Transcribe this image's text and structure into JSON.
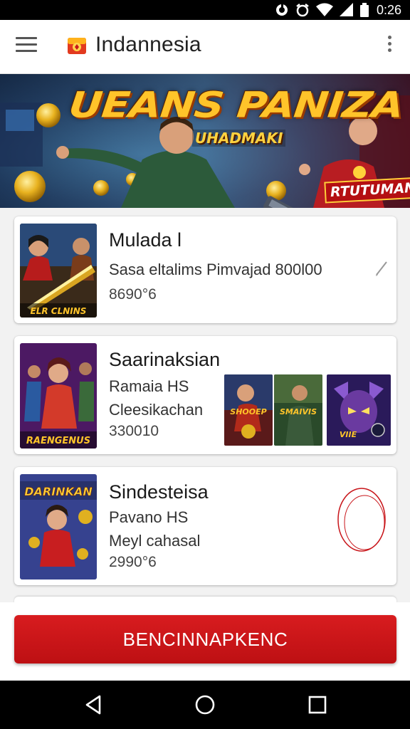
{
  "status_bar": {
    "time": "0:26",
    "icons": [
      "sync-icon",
      "alarm-icon",
      "wifi-icon",
      "signal-icon",
      "battery-icon"
    ]
  },
  "app_bar": {
    "title": "Indannesia",
    "icons": [
      "menu-icon",
      "app-logo-icon",
      "overflow-menu-icon"
    ]
  },
  "banner": {
    "title": "UEANS PANIZA",
    "subtitle": "UHADMAKI",
    "tag": "RTUTUMAN"
  },
  "cards": [
    {
      "title": "Mulada l",
      "line1": "Sasa eltalims  Pimvajad 800l00",
      "line2": "",
      "number": "8690°6",
      "thumb_caption": "ELR CLNINS",
      "action_icon": "edit-icon"
    },
    {
      "title": "Saarinaksian",
      "line1": "Ramaia HS",
      "line2": "Cleesikachan",
      "number": "330010",
      "thumb_caption": "RAENGENUS",
      "previews": [
        "SHOOEP",
        "SMAIVIS",
        "VIIE"
      ]
    },
    {
      "title": "Sindesteisa",
      "line1": "Pavano HS",
      "line2": "Meyl cahasal",
      "number": "2990°6",
      "thumb_caption": "DARINKAN",
      "action_icon": "circle-icon"
    }
  ],
  "primary_button": {
    "label": "BENCINNAPKENC"
  },
  "nav_bar": {
    "icons": [
      "back-icon",
      "home-icon",
      "recents-icon"
    ]
  },
  "colors": {
    "accent": "#c8151a",
    "banner_title": "#ffc42a",
    "status_bar": "#000000"
  }
}
